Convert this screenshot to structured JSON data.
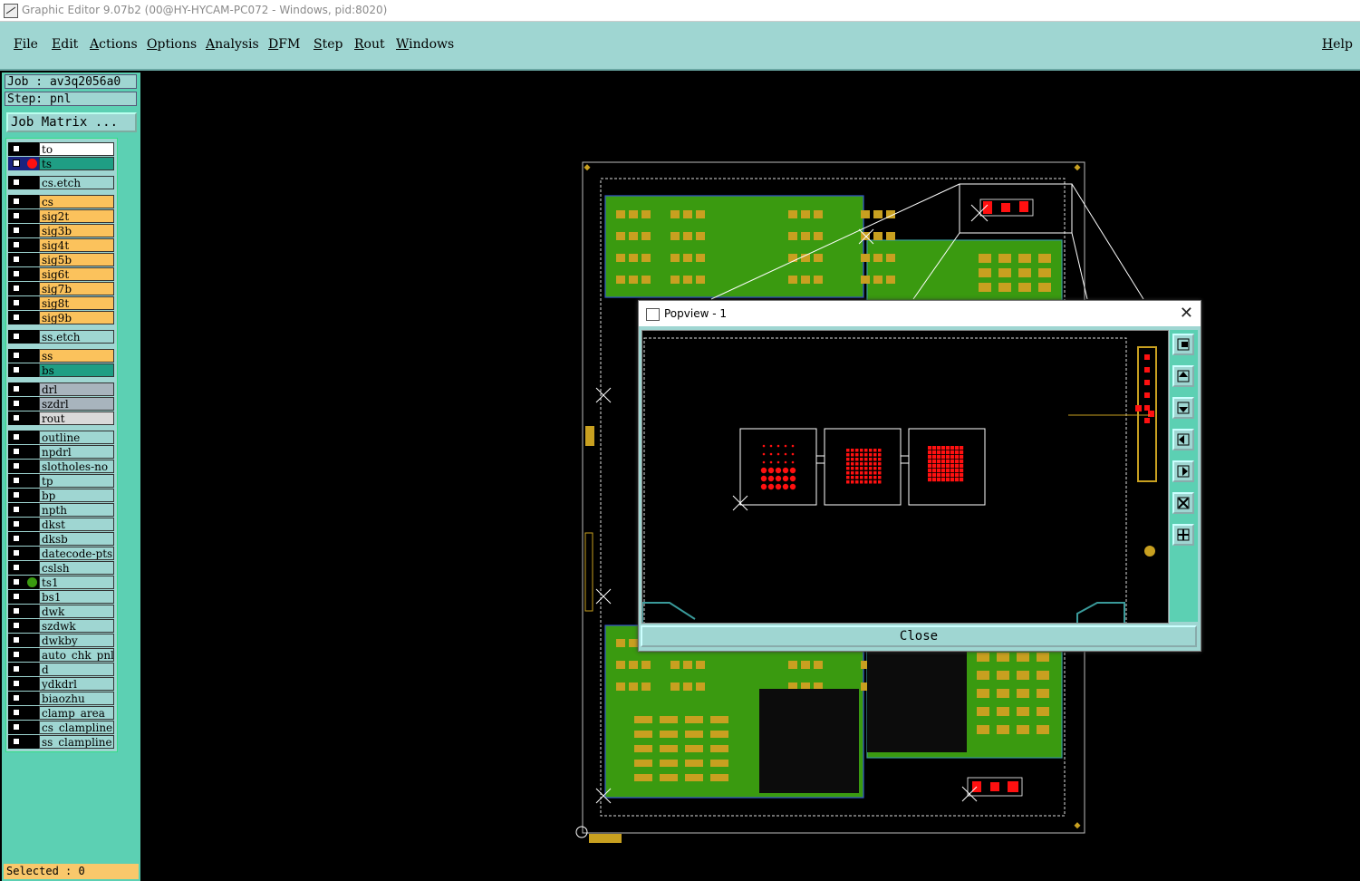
{
  "window": {
    "title": "Graphic Editor 9.07b2 (00@HY-HYCAM-PC072 - Windows, pid:8020)"
  },
  "menu": {
    "items": [
      "File",
      "Edit",
      "Actions",
      "Options",
      "Analysis",
      "DFM",
      "Step",
      "Rout",
      "Windows"
    ],
    "help": "Help"
  },
  "job": {
    "job_label": "Job : av3q2056a0",
    "step_label": "Step: pnl",
    "matrix_button": "Job Matrix ..."
  },
  "layers": [
    {
      "name": "to",
      "color": "#ffffff"
    },
    {
      "name": "ts",
      "color": "#1f9e84",
      "active": true
    },
    {
      "name": "cs.etch",
      "color": "#9fd6d2"
    },
    {
      "name": "cs",
      "color": "#fbc25c"
    },
    {
      "name": "sig2t",
      "color": "#fbc25c"
    },
    {
      "name": "sig3b",
      "color": "#fbc25c"
    },
    {
      "name": "sig4t",
      "color": "#fbc25c"
    },
    {
      "name": "sig5b",
      "color": "#fbc25c"
    },
    {
      "name": "sig6t",
      "color": "#fbc25c"
    },
    {
      "name": "sig7b",
      "color": "#fbc25c"
    },
    {
      "name": "sig8t",
      "color": "#fbc25c"
    },
    {
      "name": "sig9b",
      "color": "#fbc25c"
    },
    {
      "name": "ss.etch",
      "color": "#9fd6d2"
    },
    {
      "name": "ss",
      "color": "#fbc25c"
    },
    {
      "name": "bs",
      "color": "#1f9e84"
    },
    {
      "name": "drl",
      "color": "#a8b4bd"
    },
    {
      "name": "szdrl",
      "color": "#a8b4bd"
    },
    {
      "name": "rout",
      "color": "#d9d9d9"
    },
    {
      "name": "outline",
      "color": "#9fd6d2"
    },
    {
      "name": "npdrl",
      "color": "#9fd6d2"
    },
    {
      "name": "slotholes-no",
      "color": "#9fd6d2"
    },
    {
      "name": "tp",
      "color": "#9fd6d2"
    },
    {
      "name": "bp",
      "color": "#9fd6d2"
    },
    {
      "name": "npth",
      "color": "#9fd6d2"
    },
    {
      "name": "dkst",
      "color": "#9fd6d2"
    },
    {
      "name": "dksb",
      "color": "#9fd6d2"
    },
    {
      "name": "datecode-pts",
      "color": "#9fd6d2"
    },
    {
      "name": "cslsh",
      "color": "#9fd6d2"
    },
    {
      "name": "ts1",
      "color": "#9fd6d2",
      "marker": "green"
    },
    {
      "name": "bs1",
      "color": "#9fd6d2"
    },
    {
      "name": "dwk",
      "color": "#9fd6d2"
    },
    {
      "name": "szdwk",
      "color": "#9fd6d2"
    },
    {
      "name": "dwkby",
      "color": "#9fd6d2"
    },
    {
      "name": "auto_chk_pnl",
      "color": "#9fd6d2"
    },
    {
      "name": "d",
      "color": "#9fd6d2"
    },
    {
      "name": "ydkdrl",
      "color": "#9fd6d2"
    },
    {
      "name": "biaozhu",
      "color": "#9fd6d2"
    },
    {
      "name": "clamp_area",
      "color": "#9fd6d2"
    },
    {
      "name": "cs_clampline",
      "color": "#9fd6d2"
    },
    {
      "name": "ss_clampline",
      "color": "#9fd6d2"
    }
  ],
  "status": {
    "selected": "Selected : 0"
  },
  "popview": {
    "title": "Popview - 1",
    "close_label": "Close",
    "close_icon": "close-icon"
  },
  "colors": {
    "panel": "#5cd0b3",
    "menu": "#9fd6d2",
    "copper": "#c8a020",
    "green": "#3a9a10",
    "pad_red": "#ff1010"
  }
}
